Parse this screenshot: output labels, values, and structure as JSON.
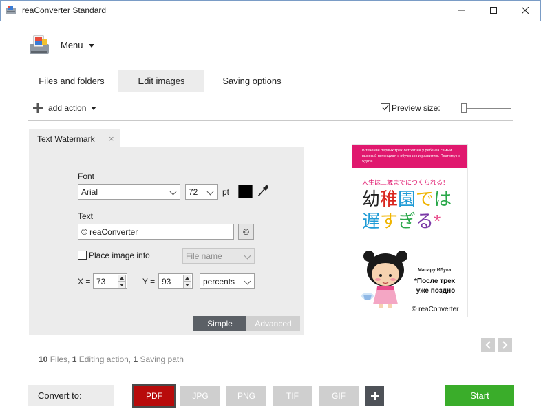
{
  "window": {
    "title": "reaConverter Standard"
  },
  "menu": {
    "label": "Menu"
  },
  "tabs": [
    {
      "label": "Files and folders"
    },
    {
      "label": "Edit images",
      "active": true
    },
    {
      "label": "Saving options"
    }
  ],
  "toolbar": {
    "add_action": "add action",
    "preview_label": "Preview size:",
    "preview_checked": true
  },
  "action": {
    "title": "Text Watermark",
    "font_label": "Font",
    "font_value": "Arial",
    "size_value": "72",
    "size_unit": "pt",
    "color": "#000000",
    "text_label": "Text",
    "text_value": "© reaConverter",
    "copyright_button": "©",
    "place_info_label": "Place image info",
    "place_info_checked": false,
    "info_select": "File name",
    "x_label": "X =",
    "x_value": "73",
    "y_label": "Y =",
    "y_value": "93",
    "units": "percents",
    "mode_simple": "Simple",
    "mode_advanced": "Advanced"
  },
  "preview_image": {
    "banner": "В течение первых трех лет жизни у ребенка самый высокий потенциал к обучению и развитию. Поэтому не ждите.",
    "subtitle": "人生は三歳までにつくられる！",
    "title_line1": "幼稚園では",
    "title_line2": "遅すぎる*",
    "author": "Масару Ибука",
    "russian_title": "*После трех\n уже поздно",
    "watermark": "© reaConverter"
  },
  "status": {
    "files_count": "10",
    "files_label": "Files,",
    "actions_count": "1",
    "actions_label": "Editing action,",
    "paths_count": "1",
    "paths_label": "Saving path"
  },
  "bottom": {
    "convert_label": "Convert to:",
    "formats": [
      "PDF",
      "JPG",
      "PNG",
      "TIF",
      "GIF"
    ],
    "selected_format": "PDF",
    "start": "Start"
  },
  "colors": {
    "accent_red": "#b80b0b",
    "start_green": "#3aad2a",
    "pink": "#e0186e"
  }
}
